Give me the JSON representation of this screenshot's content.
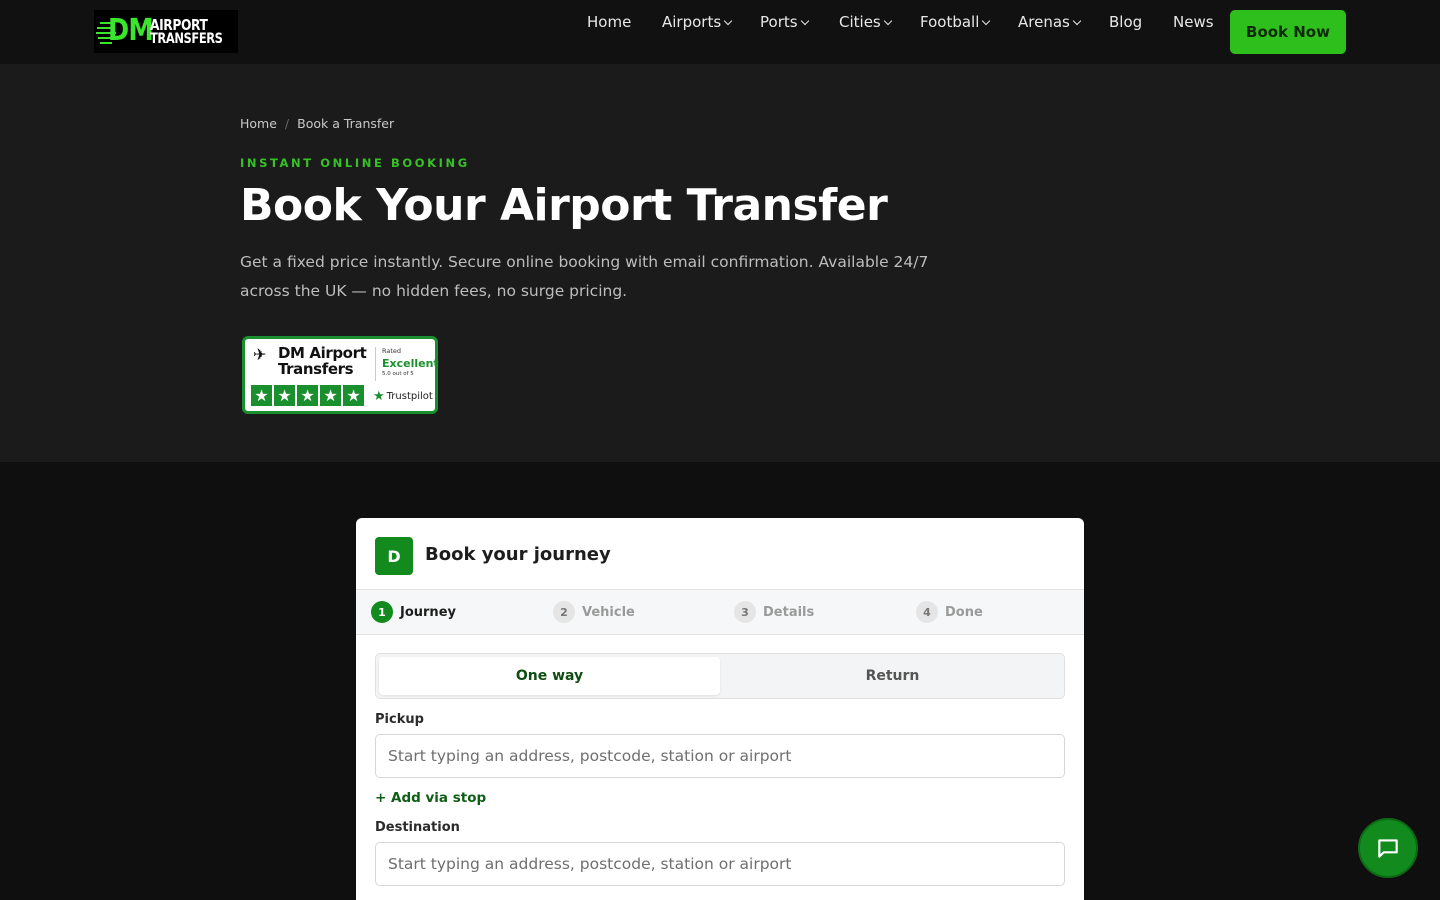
{
  "header": {
    "logo_big": "DM",
    "logo_line1": "AIRPORT",
    "logo_line2": "TRANSFERS",
    "nav": [
      {
        "label": "Home",
        "dropdown": false
      },
      {
        "label": "Airports",
        "dropdown": true
      },
      {
        "label": "Ports",
        "dropdown": true
      },
      {
        "label": "Cities",
        "dropdown": true
      },
      {
        "label": "Football",
        "dropdown": true
      },
      {
        "label": "Arenas",
        "dropdown": true
      },
      {
        "label": "Blog",
        "dropdown": false
      },
      {
        "label": "News",
        "dropdown": false
      }
    ],
    "cta": "Book Now"
  },
  "hero": {
    "breadcrumb": [
      "Home",
      "Book a Transfer"
    ],
    "eyebrow": "INSTANT ONLINE BOOKING",
    "title": "Book Your Airport Transfer",
    "subtitle": "Get a fixed price instantly. Secure online booking with email confirmation. Available 24/7 across the UK — no hidden fees, no surge pricing."
  },
  "trustpilot": {
    "name_line1": "DM Airport",
    "name_line2": "Transfers",
    "rated": "Rated",
    "rating_word": "Excellent",
    "score": "5.0 out of 5",
    "stars": 5,
    "brand": "Trustpilot"
  },
  "booking": {
    "badge": "D",
    "title": "Book your journey",
    "steps": [
      {
        "num": "1",
        "label": "Journey",
        "active": true
      },
      {
        "num": "2",
        "label": "Vehicle",
        "active": false
      },
      {
        "num": "3",
        "label": "Details",
        "active": false
      },
      {
        "num": "4",
        "label": "Done",
        "active": false
      }
    ],
    "trip_options": [
      "One way",
      "Return"
    ],
    "selected_trip": "One way",
    "pickup_label": "Pickup",
    "pickup_placeholder": "Start typing an address, postcode, station or airport",
    "pickup_value": "",
    "add_via": "+ Add via stop",
    "destination_label": "Destination",
    "destination_placeholder": "Start typing an address, postcode, station or airport",
    "destination_value": ""
  },
  "colors": {
    "accent": "#2fbf1c",
    "brand_green": "#128a1e",
    "hero_bg": "#1b1b1b",
    "header_bg": "#111111"
  },
  "icons": {
    "chat": "chat-bubble-icon",
    "plane": "airplane-icon",
    "star": "star-icon",
    "chevron": "chevron-down-icon"
  }
}
